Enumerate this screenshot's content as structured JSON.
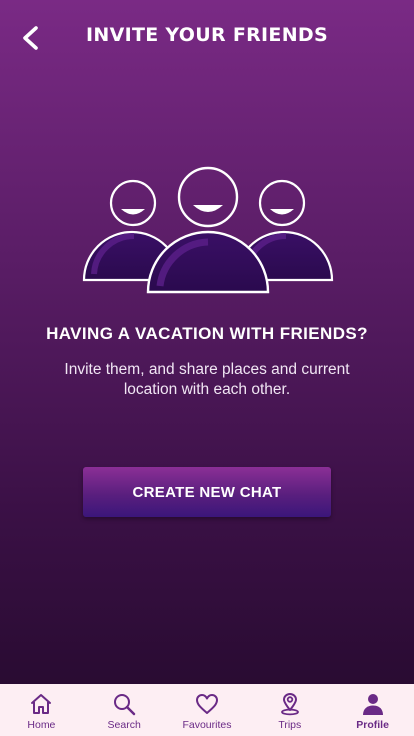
{
  "header": {
    "title": "INVITE YOUR FRIENDS",
    "back_icon": "chevron-left-icon"
  },
  "main": {
    "illustration_icon": "group-of-friends-icon",
    "headline": "HAVING A VACATION WITH FRIENDS?",
    "description": "Invite them, and share places and current location with each other.",
    "cta_label": "CREATE NEW CHAT"
  },
  "tabbar": {
    "active": "Profile",
    "items": [
      {
        "label": "Home",
        "icon": "home-icon"
      },
      {
        "label": "Search",
        "icon": "search-icon"
      },
      {
        "label": "Favourites",
        "icon": "heart-icon"
      },
      {
        "label": "Trips",
        "icon": "map-pin-icon"
      },
      {
        "label": "Profile",
        "icon": "person-icon"
      }
    ]
  },
  "colors": {
    "background_top": "#7a2a85",
    "background_bottom": "#240a2c",
    "accent": "#6a2a86",
    "tabbar_background": "#fdeef3"
  }
}
